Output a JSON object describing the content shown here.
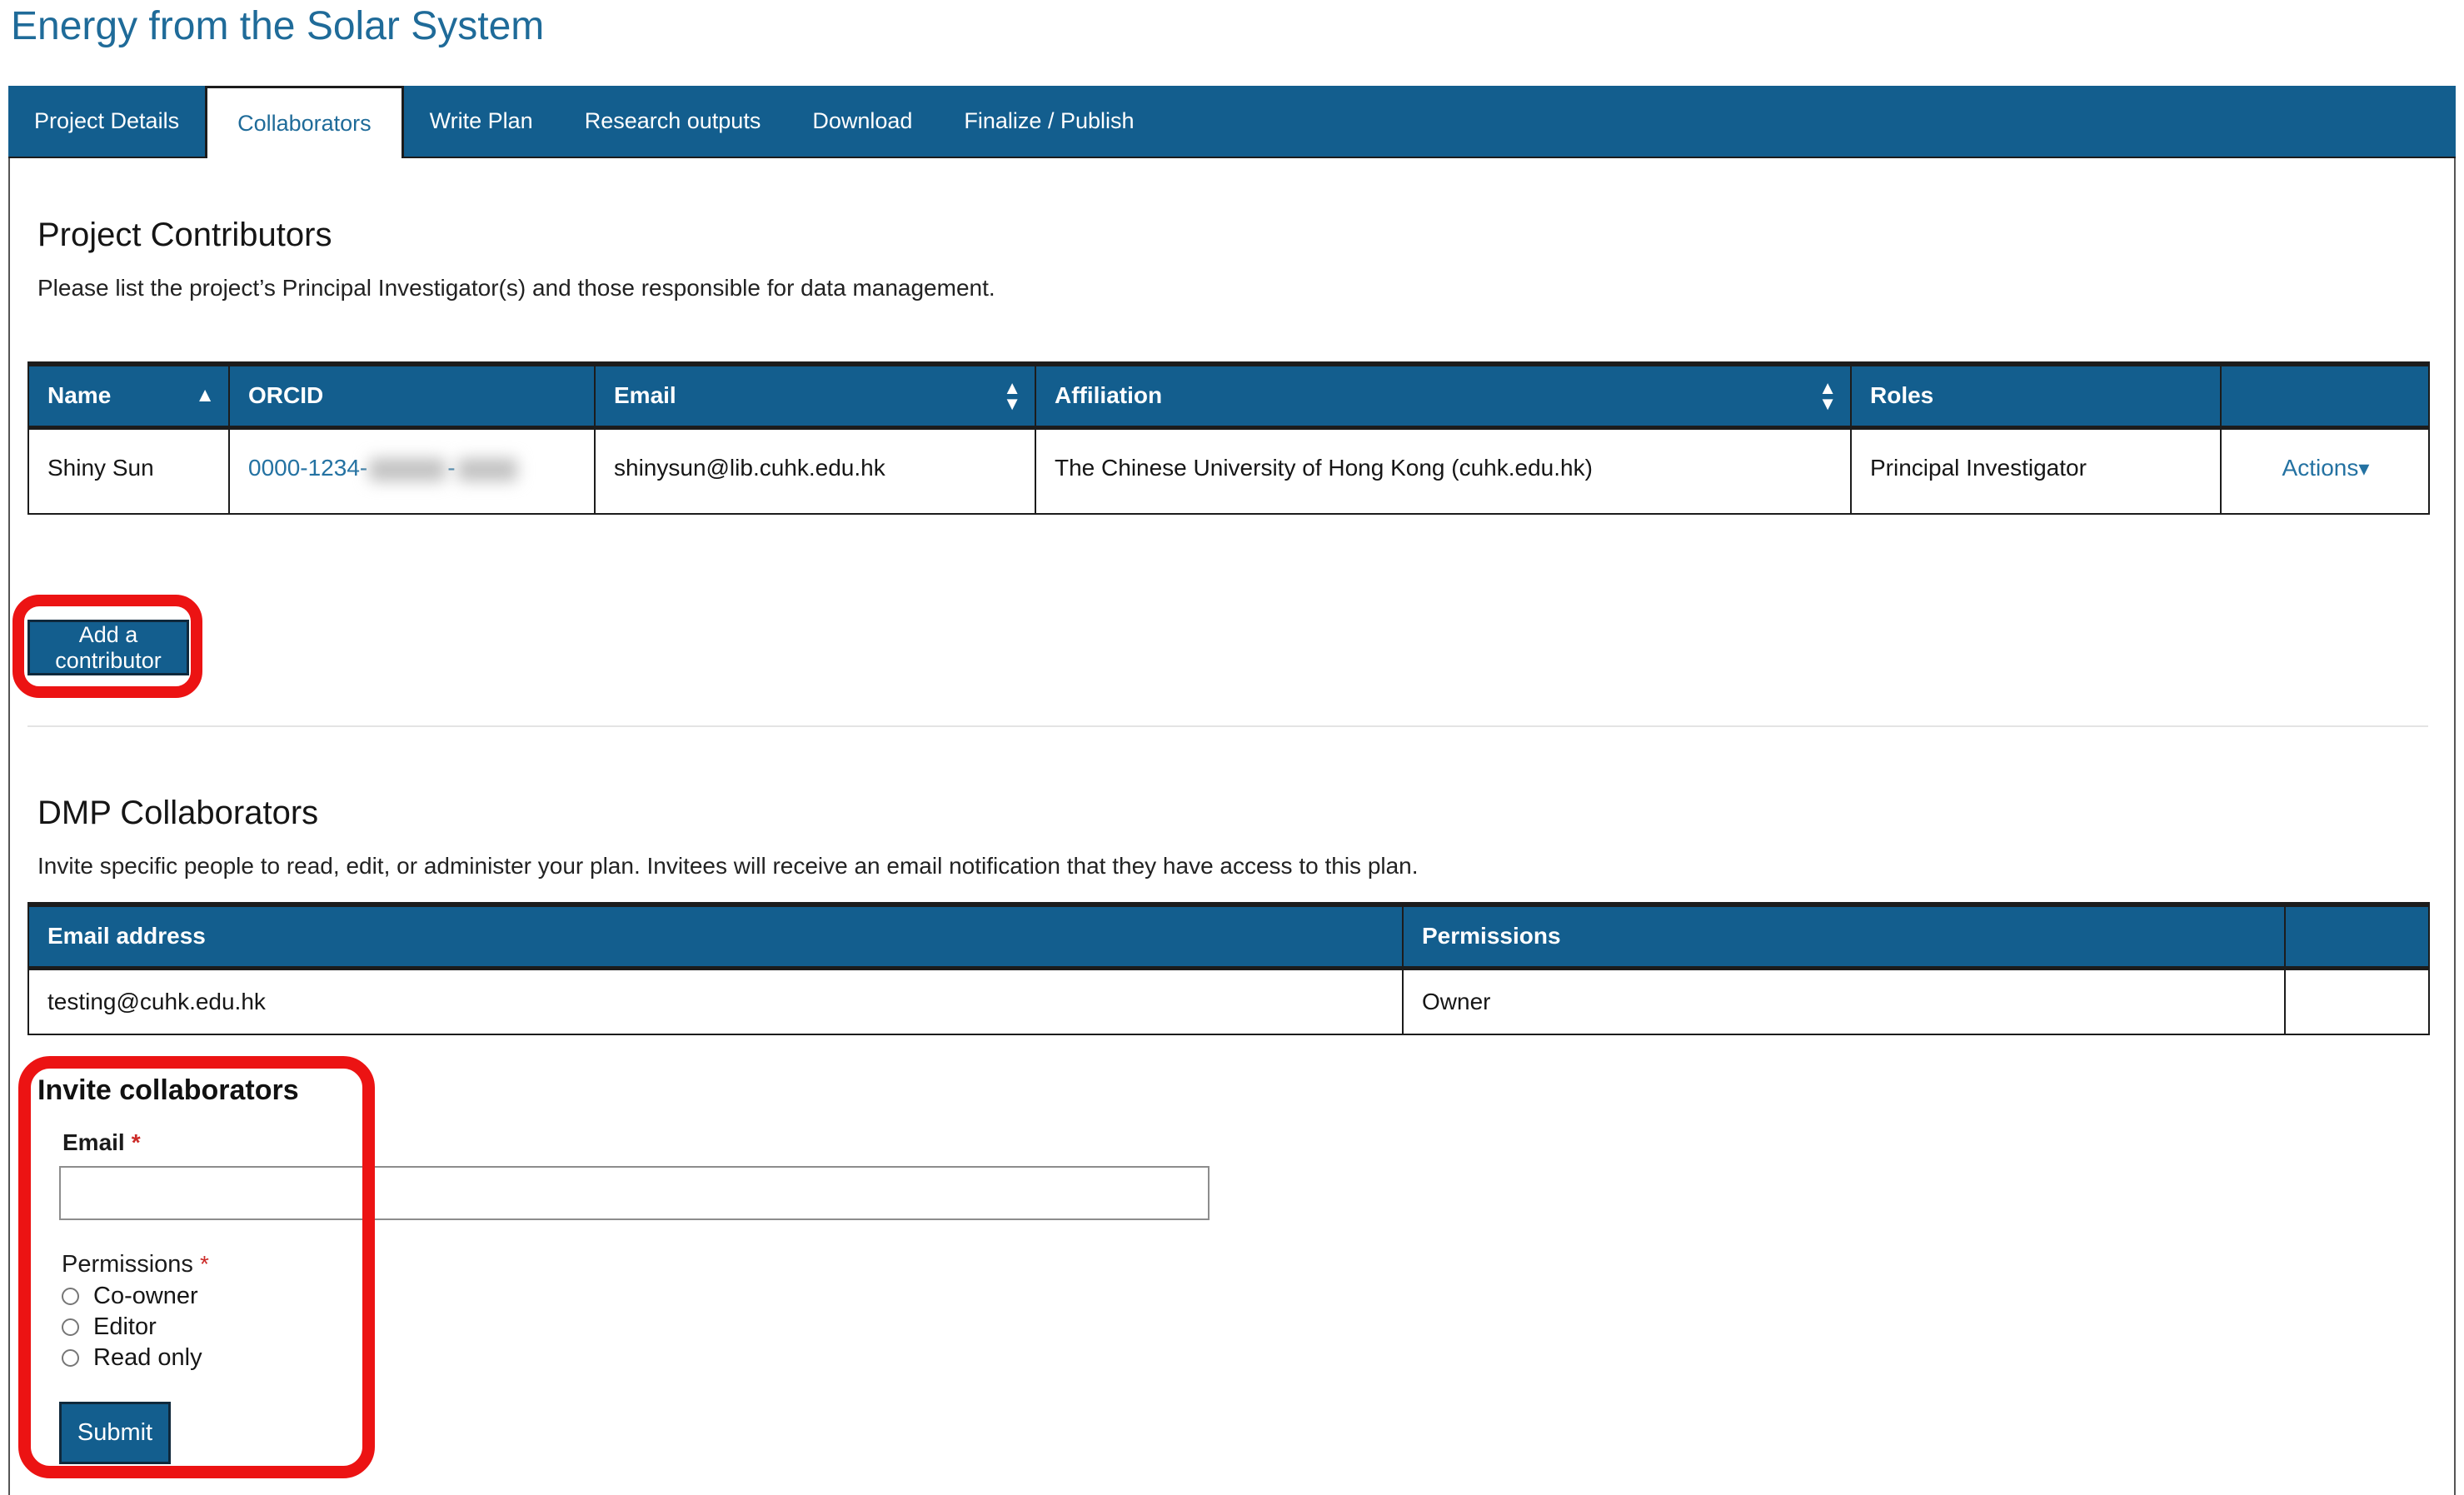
{
  "page": {
    "title": "Energy from the Solar System"
  },
  "tabs": [
    {
      "label": "Project Details",
      "active": false
    },
    {
      "label": "Collaborators",
      "active": true
    },
    {
      "label": "Write Plan",
      "active": false
    },
    {
      "label": "Research outputs",
      "active": false
    },
    {
      "label": "Download",
      "active": false
    },
    {
      "label": "Finalize / Publish",
      "active": false
    }
  ],
  "contributors": {
    "heading": "Project Contributors",
    "description": "Please list the project’s Principal Investigator(s) and those responsible for data management.",
    "table": {
      "headers": {
        "name": "Name",
        "orcid": "ORCID",
        "email": "Email",
        "affiliation": "Affiliation",
        "roles": "Roles",
        "actions": ""
      },
      "row": {
        "name": "Shiny Sun",
        "orcid_prefix": "0000-1234-",
        "orcid_separator": "-",
        "email": "shinysun@lib.cuhk.edu.hk",
        "affiliation": "The Chinese University of Hong Kong (cuhk.edu.hk)",
        "roles": "Principal Investigator",
        "actions_label": "Actions"
      }
    },
    "add_button_label": "Add a contributor"
  },
  "dmp_collaborators": {
    "heading": "DMP Collaborators",
    "description": "Invite specific people to read, edit, or administer your plan. Invitees will receive an email notification that they have access to this plan.",
    "table": {
      "headers": {
        "email": "Email address",
        "permissions": "Permissions"
      },
      "row": {
        "email": "testing@cuhk.edu.hk",
        "permissions": "Owner"
      }
    }
  },
  "invite": {
    "heading": "Invite collaborators",
    "email_label": "Email",
    "required_marker": "*",
    "email_value": "",
    "permissions_label": "Permissions",
    "options": [
      {
        "label": "Co-owner"
      },
      {
        "label": "Editor"
      },
      {
        "label": "Read only"
      }
    ],
    "submit_label": "Submit"
  },
  "icons": {
    "sort_asc": "▲",
    "sort_up": "▲",
    "sort_down": "▼",
    "caret_down": "▾"
  },
  "colors": {
    "brand-blue": "#135e8e",
    "title-blue": "#1f6b99",
    "link-blue": "#2472a2",
    "annotation-red": "#ec1313",
    "required-red": "#cc2a27"
  }
}
